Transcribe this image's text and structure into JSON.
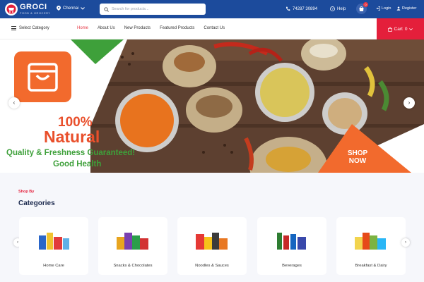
{
  "brand": {
    "name": "GROCI",
    "tagline": "FOOD & GROCERY"
  },
  "topbar": {
    "location": "Chennai",
    "search_placeholder": "Search for products...",
    "phone": "74287 30894",
    "help": "Help",
    "cart_count": "0",
    "login": "Login",
    "register": "Register"
  },
  "nav": {
    "select_category": "Select Category",
    "links": [
      "Home",
      "About Us",
      "New Products",
      "Featured Products",
      "Contact Us"
    ],
    "cart_label": "Cart",
    "cart_value": "0"
  },
  "hero": {
    "headline_1": "100%",
    "headline_2": "Natural",
    "tagline_1": "Quality & Freshness Guaranteed!",
    "tagline_2": "Good Health",
    "cta": "SHOP NOW",
    "prev": "‹",
    "next": "›"
  },
  "categories": {
    "eyebrow": "Shop By",
    "title": "Categories",
    "items": [
      "Home Care",
      "Snacks & Chocolates",
      "Noodles & Sauces",
      "Beverages",
      "Breakfast & Dairy"
    ],
    "prev": "‹",
    "next": "›"
  },
  "colors": {
    "topbar": "#1c4b9c",
    "accent_red": "#e41f3b",
    "orange": "#f26a2d",
    "green": "#3ea03a"
  }
}
